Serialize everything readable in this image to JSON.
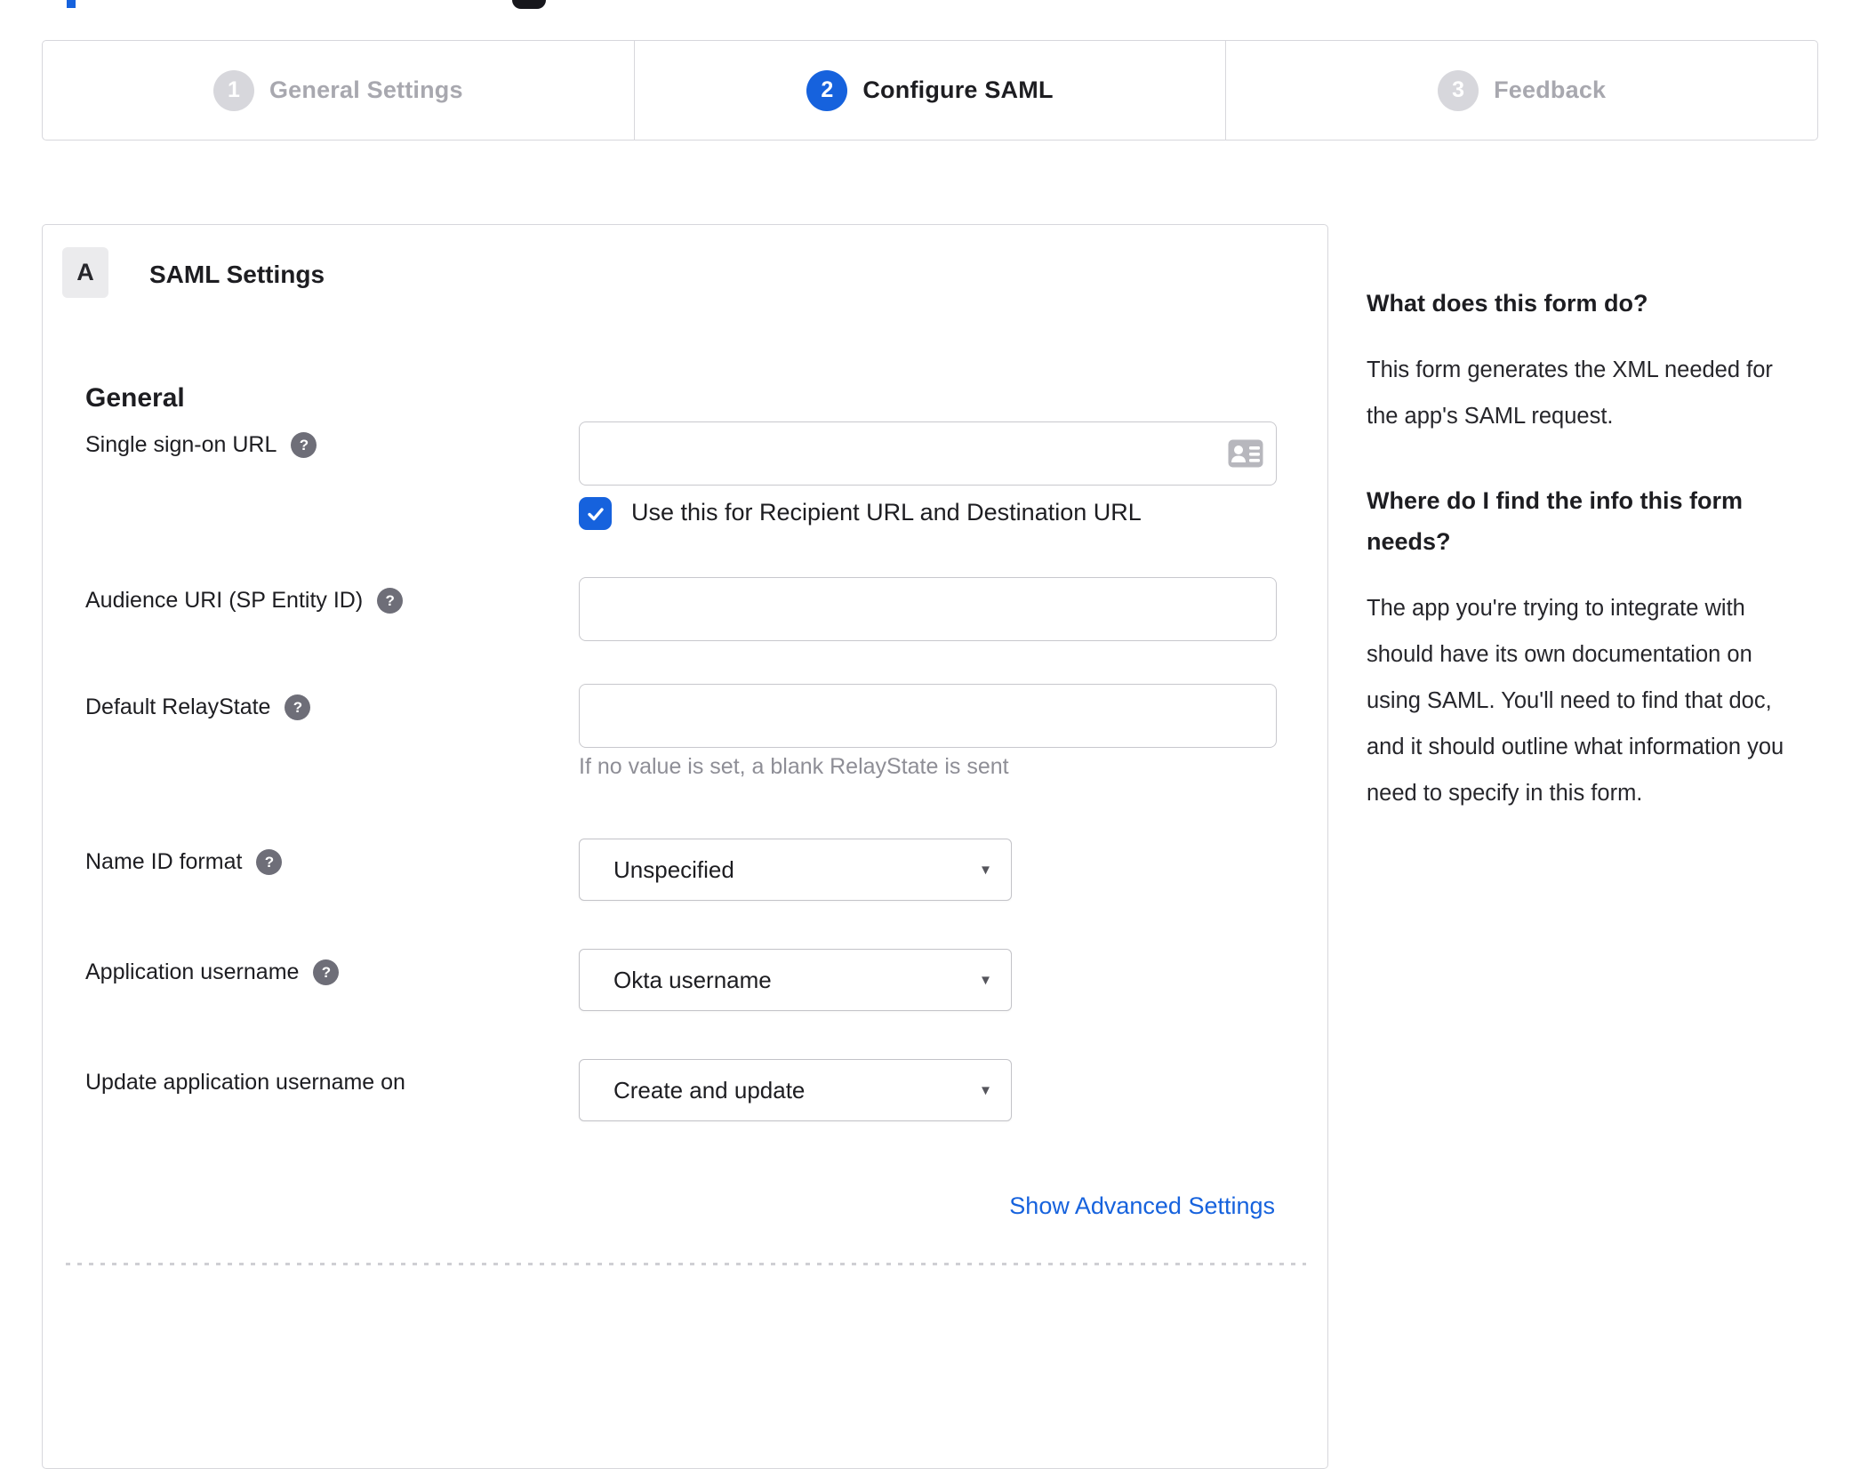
{
  "colors": {
    "accent_blue": "#1662dd",
    "border_gray": "#d7d7dc",
    "inactive_step_gray": "#a8a8af",
    "help_icon_gray": "#6e6e78",
    "hint_gray": "#8e8e96"
  },
  "stepper": {
    "steps": [
      {
        "number": "1",
        "label": "General Settings",
        "active": false
      },
      {
        "number": "2",
        "label": "Configure SAML",
        "active": true
      },
      {
        "number": "3",
        "label": "Feedback",
        "active": false
      }
    ]
  },
  "panel": {
    "section_letter": "A",
    "section_title": "SAML Settings",
    "group_heading": "General",
    "sso": {
      "label": "Single sign-on URL",
      "value": "",
      "checkbox_label": "Use this for Recipient URL and Destination URL",
      "checked": true
    },
    "audience": {
      "label": "Audience URI (SP Entity ID)",
      "value": ""
    },
    "relay": {
      "label": "Default RelayState",
      "value": "",
      "hint": "If no value is set, a blank RelayState is sent"
    },
    "name_id": {
      "label": "Name ID format",
      "value": "Unspecified"
    },
    "app_username": {
      "label": "Application username",
      "value": "Okta username"
    },
    "update_username": {
      "label": "Update application username on",
      "value": "Create and update"
    },
    "advanced_link": "Show Advanced Settings"
  },
  "sidebar": {
    "heading1": "What does this form do?",
    "para1": "This form generates the XML needed for the app's SAML request.",
    "heading2": "Where do I find the info this form needs?",
    "para2": "The app you're trying to integrate with should have its own documentation on using SAML. You'll need to find that doc, and it should outline what information you need to specify in this form."
  },
  "icons": {
    "help": "?",
    "dropdown_arrow": "▾"
  }
}
